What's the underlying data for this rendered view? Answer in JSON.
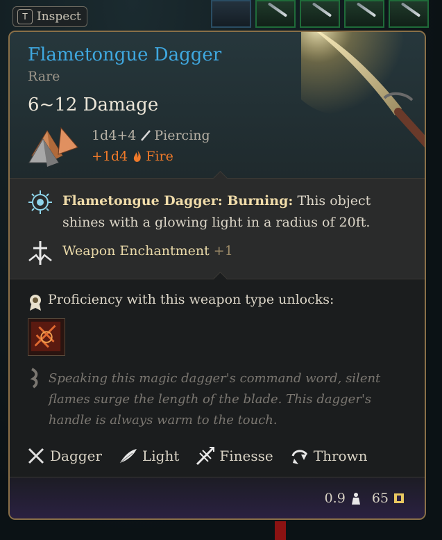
{
  "inspect": {
    "key": "T",
    "label": "Inspect"
  },
  "item": {
    "name": "Flametongue Dagger",
    "rarity": "Rare",
    "damage": "6~12 Damage",
    "base_roll": "1d4+4",
    "base_type": "Piercing",
    "bonus_roll": "+1d4",
    "bonus_type": "Fire",
    "passive_name": "Flametongue Dagger: Burning:",
    "passive_desc": "This object shines with a glowing light in a radius of 20ft.",
    "enchant_label": "Weapon Enchantment",
    "enchant_bonus": "+1",
    "proficiency_label": "Proficiency with this weapon type unlocks:",
    "flavor": "Speaking this magic dagger's command word, silent flames surge the length of the blade. This dagger's handle is always warm to the touch.",
    "properties": [
      "Dagger",
      "Light",
      "Finesse",
      "Thrown"
    ],
    "weight": "0.9",
    "value": "65"
  },
  "colors": {
    "name": "#3fa8e0",
    "fire": "#f07a2a",
    "border": "#8a7048"
  },
  "icons": [
    "piercing-icon",
    "fire-icon",
    "burning-passive-icon",
    "weapon-enchantment-icon",
    "proficiency-icon",
    "weapon-action-icon",
    "flavor-icon",
    "dagger-icon",
    "light-icon",
    "finesse-icon",
    "thrown-icon",
    "weight-icon",
    "gold-icon"
  ]
}
